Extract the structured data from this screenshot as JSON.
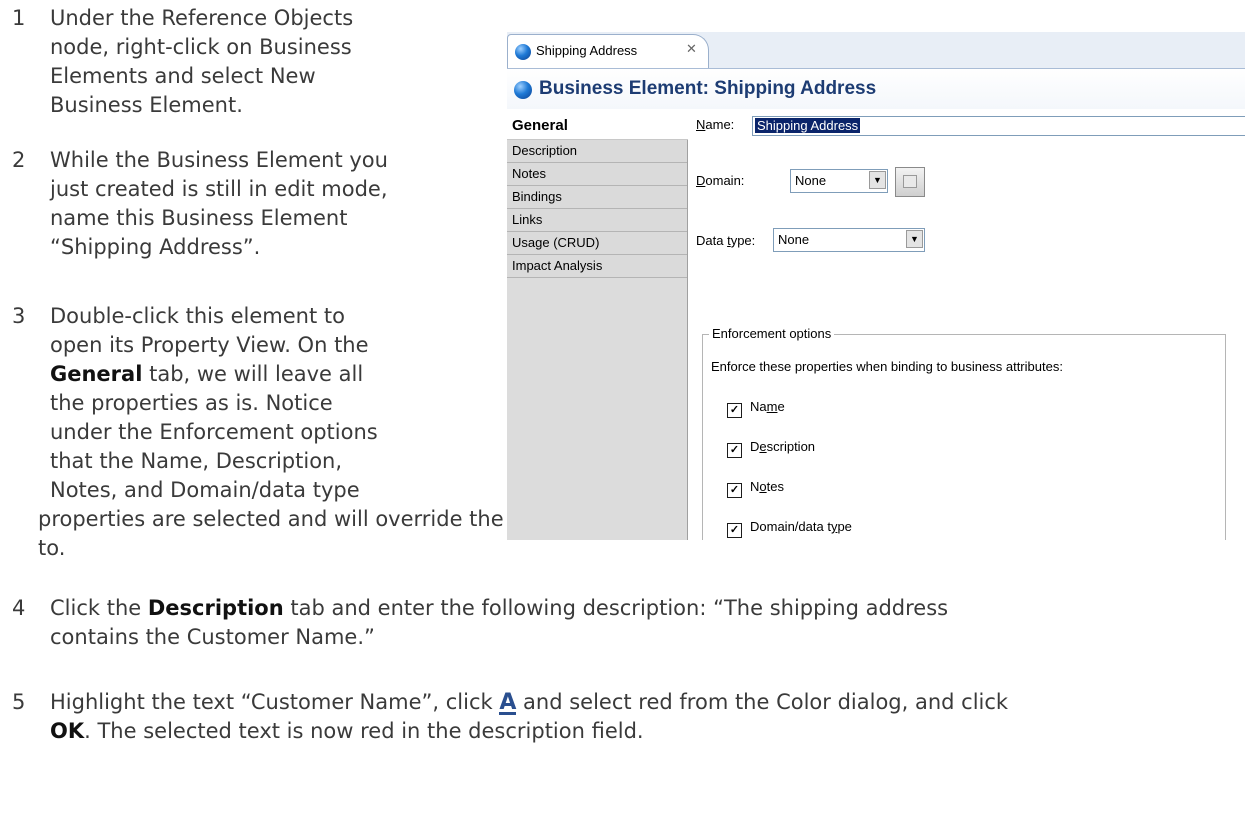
{
  "steps": [
    {
      "num": "1",
      "lines": [
        "Under the Reference Objects",
        "node, right-click on Business",
        "Elements and select New",
        "Business Element."
      ]
    },
    {
      "num": "2",
      "lines": [
        "While the Business Element you",
        "just created is still in edit mode,",
        "name this Business Element",
        "“Shipping Address”."
      ]
    },
    {
      "num": "3",
      "lines": [
        "Double-click this element to",
        "open its Property View. On the",
        "tab, we will leave all",
        "the properties as is. Notice",
        "under the Enforcement options",
        "that the Name, Description,",
        "Notes, and Domain/data type"
      ],
      "bold_general": "General",
      "continuation": "properties are selected and will override the properties of the Business Attribute it is bound",
      "continuation2": "to."
    },
    {
      "num": "4",
      "pre": "Click the ",
      "bold": "Description",
      "post": " tab and enter the following description: “The shipping address",
      "line2": "contains the Customer Name.”"
    },
    {
      "num": "5",
      "pre": "Highlight the text “Customer Name”, click ",
      "glyph": "A",
      "post": " and select red from the Color dialog, and click",
      "bold2": "OK",
      "line2": ". The selected text is now red in the description field."
    }
  ],
  "screenshot": {
    "editor_tab": {
      "label": "Shipping Address",
      "close": "✕",
      "icon": "business-element-icon"
    },
    "header_title": "Business Element: Shipping Address",
    "tabs": [
      "General",
      "Description",
      "Notes",
      "Bindings",
      "Links",
      "Usage (CRUD)",
      "Impact Analysis"
    ],
    "selected_tab": "General",
    "name_label_u": "N",
    "name_label": "ame:",
    "name_value": "Shipping Address",
    "domain_label_u": "D",
    "domain_label": "omain:",
    "domain_value": "None",
    "datatype_label_pre": "Data ",
    "datatype_label_u": "t",
    "datatype_label": "ype:",
    "datatype_value": "None",
    "enforcement_legend": "Enforcement options",
    "enforcement_text": "Enforce these properties when binding to business attributes:",
    "checkboxes": [
      {
        "pre": "Na",
        "u": "m",
        "post": "e",
        "checked": true
      },
      {
        "pre": "D",
        "u": "e",
        "post": "scription",
        "checked": true
      },
      {
        "pre": "N",
        "u": "o",
        "post": "tes",
        "checked": true
      },
      {
        "pre": "Domain/data t",
        "u": "y",
        "post": "pe",
        "checked": true
      }
    ]
  }
}
